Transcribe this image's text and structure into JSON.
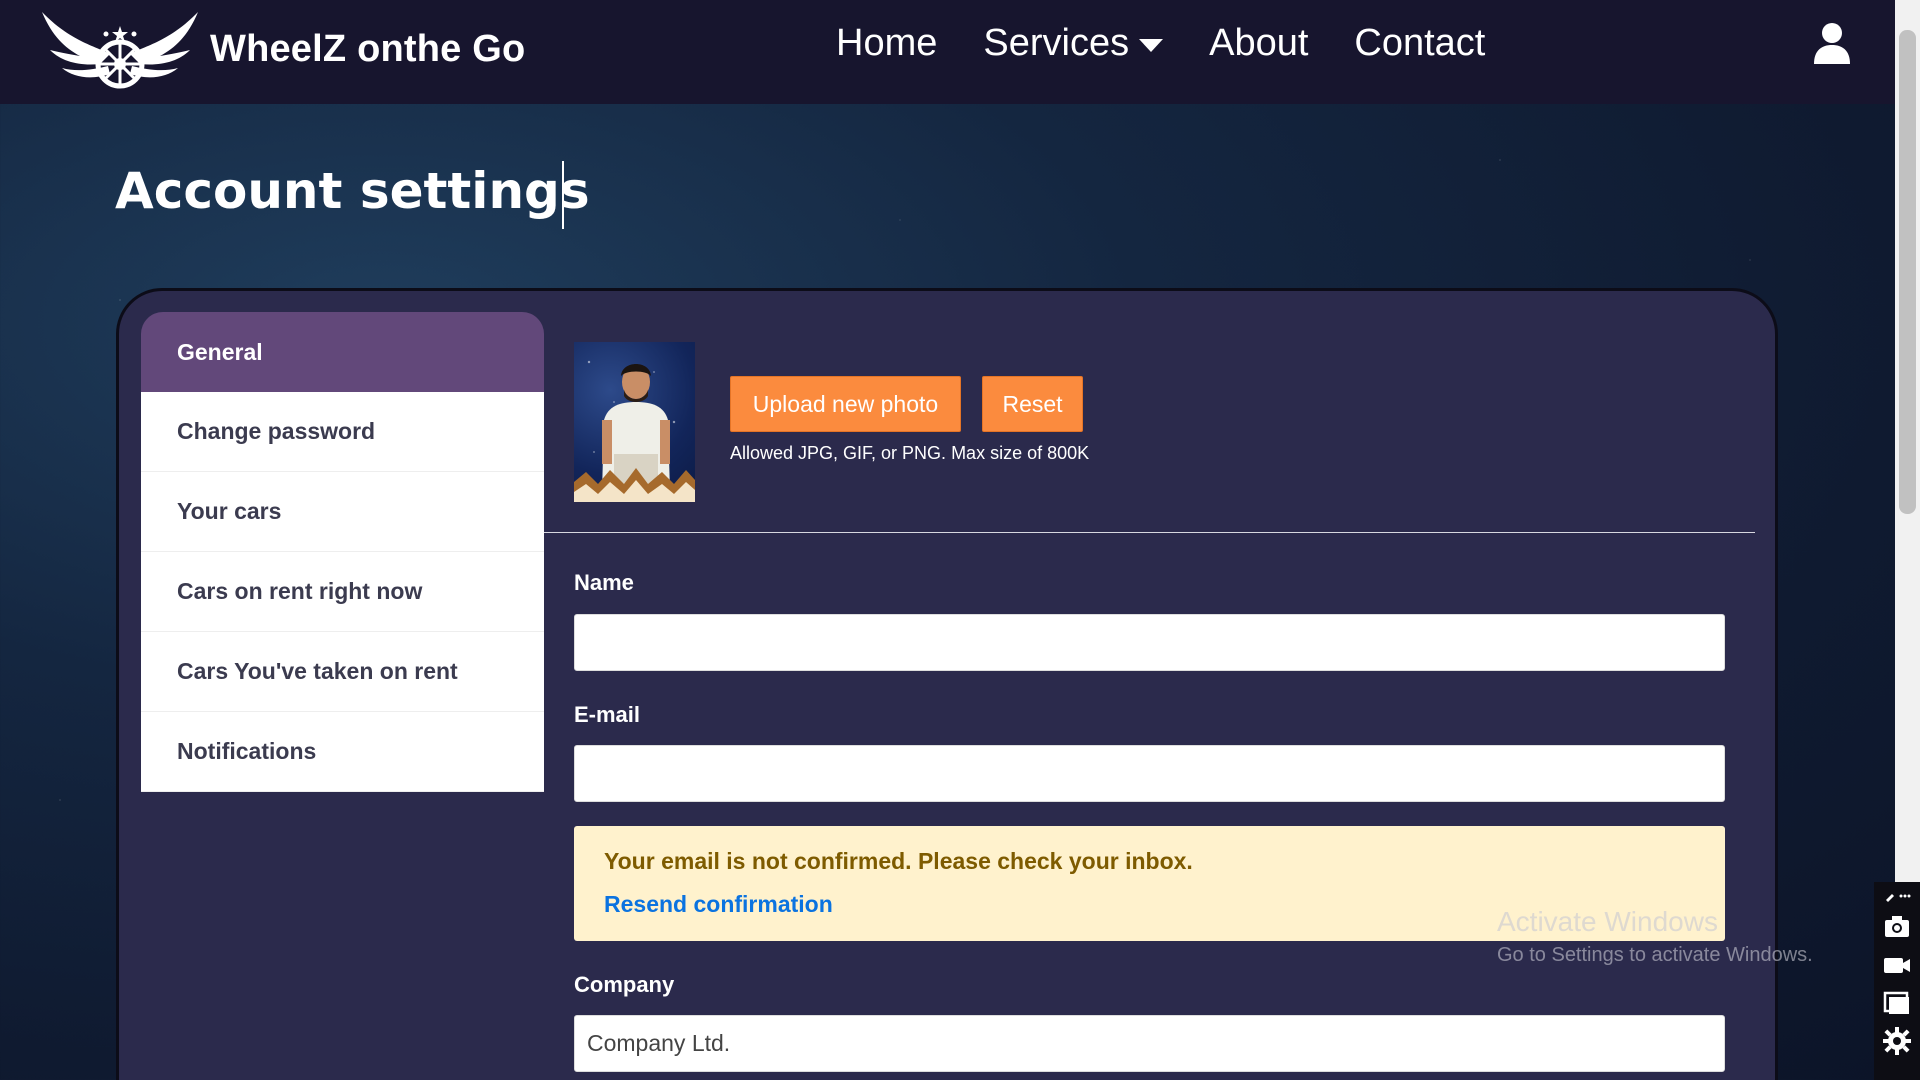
{
  "navbar": {
    "brand_name": "WheelZ onthe Go",
    "links": {
      "home": "Home",
      "services": "Services",
      "about": "About",
      "contact": "Contact"
    },
    "user_icon": "user-icon"
  },
  "page": {
    "title": "Account settings"
  },
  "sidebar": {
    "items": [
      {
        "label": "General",
        "active": true
      },
      {
        "label": "Change password"
      },
      {
        "label": "Your cars"
      },
      {
        "label": "Cars on rent right now"
      },
      {
        "label": "Cars You've taken on rent"
      },
      {
        "label": "Notifications"
      }
    ]
  },
  "photo": {
    "upload_label": "Upload new photo",
    "reset_label": "Reset",
    "allowed_text": "Allowed JPG, GIF, or PNG. Max size of 800K"
  },
  "form": {
    "name_label": "Name",
    "name_value": "",
    "email_label": "E-mail",
    "email_value": "",
    "company_label": "Company",
    "company_value": "Company Ltd."
  },
  "alert": {
    "message": "Your email is not confirmed. Please check your inbox.",
    "link": "Resend confirmation"
  },
  "watermark": {
    "title": "Activate Windows",
    "subtitle": "Go to Settings to activate Windows."
  },
  "colors": {
    "navbar_bg": "#17152e",
    "card_bg": "#2b2a4c",
    "active_tab": "#62487a",
    "button": "#fb8b3e",
    "alert_bg": "#fff2cd",
    "alert_text": "#7e5b00",
    "link": "#0b73e0"
  }
}
